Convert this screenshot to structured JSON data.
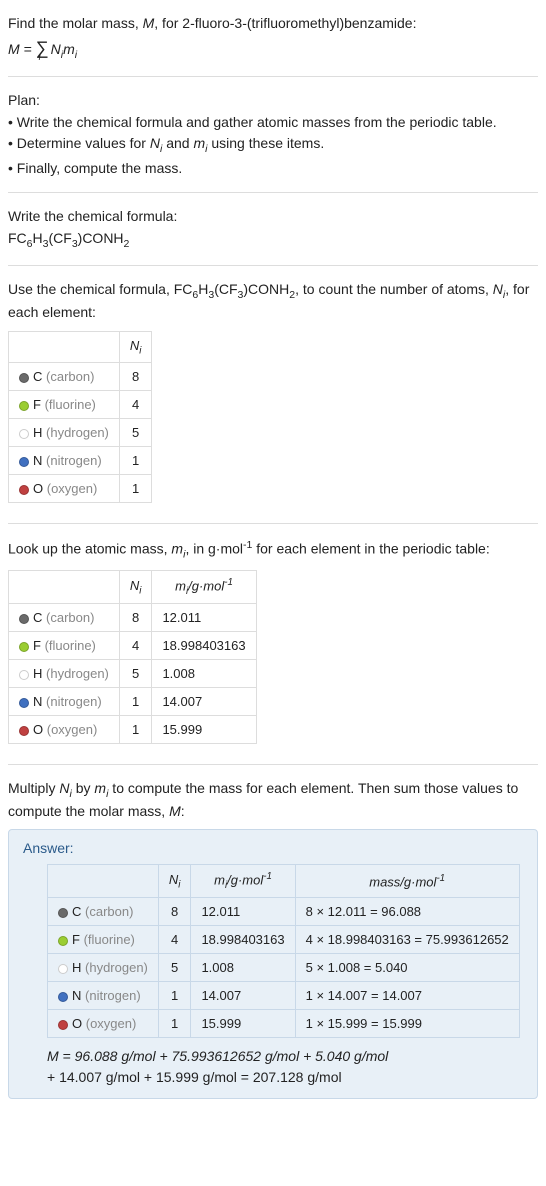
{
  "intro": {
    "line1a": "Find the molar mass, ",
    "line1b": "M",
    "line1c": ", for 2-fluoro-3-(trifluoromethyl)benzamide:",
    "eq_lhs": "M = ",
    "eq_sigma": "∑",
    "eq_sub": "i",
    "eq_rhs_a": "N",
    "eq_rhs_b": "i",
    "eq_rhs_c": "m",
    "eq_rhs_d": "i"
  },
  "plan": {
    "title": "Plan:",
    "b1a": "• Write the chemical formula and gather atomic masses from the periodic table.",
    "b2a": "• Determine values for ",
    "b2b": "N",
    "b2c": "i",
    "b2d": " and ",
    "b2e": "m",
    "b2f": "i",
    "b2g": " using these items.",
    "b3": "• Finally, compute the mass."
  },
  "formula_section": {
    "title": "Write the chemical formula:",
    "f1": "FC",
    "f2": "6",
    "f3": "H",
    "f4": "3",
    "f5": "(CF",
    "f6": "3",
    "f7": ")CONH",
    "f8": "2"
  },
  "count_section": {
    "t1": "Use the chemical formula, FC",
    "t2": "6",
    "t3": "H",
    "t4": "3",
    "t5": "(CF",
    "t6": "3",
    "t7": ")CONH",
    "t8": "2",
    "t9": ", to count the number of atoms, ",
    "t10": "N",
    "t11": "i",
    "t12": ", for each element:",
    "header_ni_a": "N",
    "header_ni_b": "i"
  },
  "elements": [
    {
      "color": "#6a6a6a",
      "name": "C",
      "label": "(carbon)",
      "ni": "8",
      "mi": "12.011",
      "mass": "8 × 12.011 = 96.088"
    },
    {
      "color": "#9acd32",
      "name": "F",
      "label": "(fluorine)",
      "ni": "4",
      "mi": "18.998403163",
      "mass": "4 × 18.998403163 = 75.993612652"
    },
    {
      "color": "#ffffff",
      "name": "H",
      "label": "(hydrogen)",
      "ni": "5",
      "mi": "1.008",
      "mass": "5 × 1.008 = 5.040"
    },
    {
      "color": "#4070c0",
      "name": "N",
      "label": "(nitrogen)",
      "ni": "1",
      "mi": "14.007",
      "mass": "1 × 14.007 = 14.007"
    },
    {
      "color": "#c04040",
      "name": "O",
      "label": "(oxygen)",
      "ni": "1",
      "mi": "15.999",
      "mass": "1 × 15.999 = 15.999"
    }
  ],
  "mass_section": {
    "t1": "Look up the atomic mass, ",
    "t2": "m",
    "t3": "i",
    "t4": ", in g·mol",
    "t5": "-1",
    "t6": " for each element in the periodic table:",
    "hdr_mi_a": "m",
    "hdr_mi_b": "i",
    "hdr_mi_c": "/g·mol",
    "hdr_mi_d": "-1"
  },
  "mult_section": {
    "t1": "Multiply ",
    "t2": "N",
    "t3": "i",
    "t4": " by ",
    "t5": "m",
    "t6": "i",
    "t7": " to compute the mass for each element. Then sum those values to compute the molar mass, ",
    "t8": "M",
    "t9": ":"
  },
  "answer": {
    "label": "Answer:",
    "hdr_mass_a": "mass/g·mol",
    "hdr_mass_b": "-1",
    "eq1": "M = 96.088 g/mol + 75.993612652 g/mol + 5.040 g/mol",
    "eq2": "+ 14.007 g/mol + 15.999 g/mol = 207.128 g/mol"
  }
}
